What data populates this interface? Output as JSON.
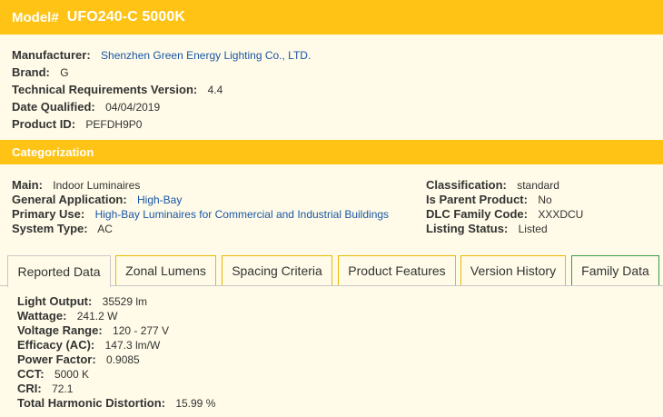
{
  "model": {
    "label": "Model#",
    "value": "UFO240-C 5000K"
  },
  "info": [
    {
      "key": "Manufacturer:",
      "value": "Shenzhen Green Energy Lighting Co., LTD.",
      "link": true
    },
    {
      "key": "Brand:",
      "value": "G",
      "link": false
    },
    {
      "key": "Technical Requirements Version:",
      "value": "4.4",
      "link": false
    },
    {
      "key": "Date Qualified:",
      "value": "04/04/2019",
      "link": false
    },
    {
      "key": "Product ID:",
      "value": "PEFDH9P0",
      "link": false
    }
  ],
  "categorization": {
    "title": "Categorization",
    "left": [
      {
        "key": "Main:",
        "value": "Indoor Luminaires",
        "link": false
      },
      {
        "key": "General Application:",
        "value": "High-Bay",
        "link": true
      },
      {
        "key": "Primary Use:",
        "value": "High-Bay Luminaires for Commercial and Industrial Buildings",
        "link": true
      },
      {
        "key": "System Type:",
        "value": "AC",
        "link": false
      }
    ],
    "right": [
      {
        "key": "Classification:",
        "value": "standard",
        "link": false
      },
      {
        "key": "Is Parent Product:",
        "value": "No",
        "link": false
      },
      {
        "key": "DLC Family Code:",
        "value": "XXXDCU",
        "link": false
      },
      {
        "key": "Listing Status:",
        "value": "Listed",
        "link": false
      }
    ]
  },
  "tabs": [
    {
      "label": "Reported Data",
      "active": true
    },
    {
      "label": "Zonal Lumens",
      "active": false
    },
    {
      "label": "Spacing Criteria",
      "active": false
    },
    {
      "label": "Product Features",
      "active": false
    },
    {
      "label": "Version History",
      "active": false
    },
    {
      "label": "Family Data",
      "active": false
    }
  ],
  "reported": [
    {
      "key": "Light Output:",
      "value": "35529 lm"
    },
    {
      "key": "Wattage:",
      "value": "241.2 W"
    },
    {
      "key": "Voltage Range:",
      "value": "120 - 277 V"
    },
    {
      "key": "Efficacy (AC):",
      "value": "147.3 lm/W"
    },
    {
      "key": "Power Factor:",
      "value": "0.9085"
    },
    {
      "key": "CCT:",
      "value": "5000 K"
    },
    {
      "key": "CRI:",
      "value": "72.1"
    },
    {
      "key": "Total Harmonic Distortion:",
      "value": "15.99 %"
    }
  ],
  "colors": {
    "accent": "#fec315",
    "link": "#1a56a6",
    "family_tab_border": "#3a9a4a"
  }
}
